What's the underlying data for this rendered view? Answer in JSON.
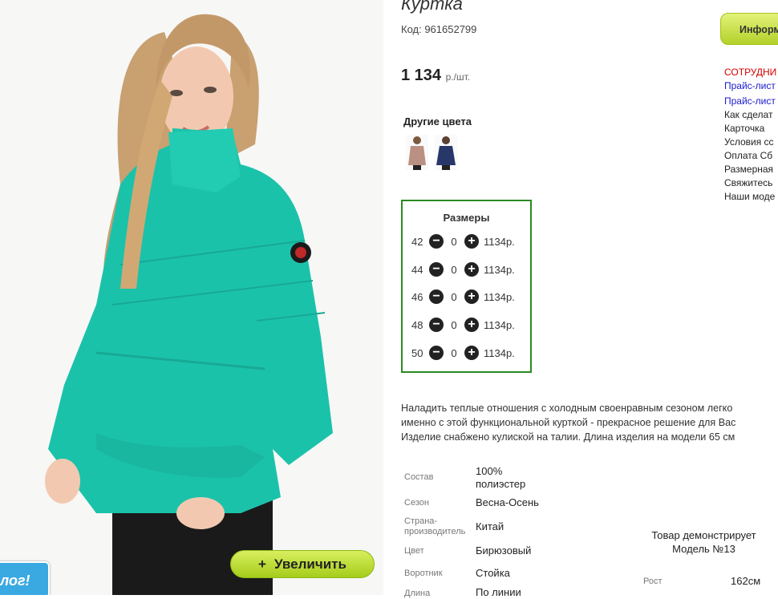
{
  "product": {
    "title": "Куртка",
    "code": "Код: 961652799",
    "price": "1 134",
    "price_unit": "р./шт."
  },
  "other_colors": {
    "label": "Другие цвета",
    "swatches": [
      {
        "name": "beige",
        "color": "#b99081"
      },
      {
        "name": "navy",
        "color": "#27376a"
      }
    ]
  },
  "sizes": {
    "title": "Размеры",
    "rows": [
      {
        "size": "42",
        "qty": "0",
        "price": "1134р."
      },
      {
        "size": "44",
        "qty": "0",
        "price": "1134р."
      },
      {
        "size": "46",
        "qty": "0",
        "price": "1134р."
      },
      {
        "size": "48",
        "qty": "0",
        "price": "1134р."
      },
      {
        "size": "50",
        "qty": "0",
        "price": "1134р."
      }
    ],
    "minus_glyph": "−",
    "plus_glyph": "+"
  },
  "description": [
    "Наладить теплые отношения с холодным своенравным сезоном легко",
    "именно с этой функциональной курткой - прекрасное решение для Вас",
    "Изделие снабжено кулиской на талии. Длина изделия на модели 65 см"
  ],
  "specs": [
    {
      "label": "Состав",
      "value": "100% полиэстер"
    },
    {
      "label": "Сезон",
      "value": "Весна-Осень"
    },
    {
      "label": "Страна-производитель",
      "value": "Китай"
    },
    {
      "label": "Цвет",
      "value": "Бирюзовый"
    },
    {
      "label": "Воротник",
      "value": "Стойка"
    },
    {
      "label": "Длина",
      "value": "По линии"
    }
  ],
  "model": {
    "note_line1": "Товар демонстрирует",
    "note_line2": "Модель №13",
    "height_label": "Рост",
    "height_value": "162см"
  },
  "zoom_button": {
    "icon": "+",
    "label": "Увеличить"
  },
  "catalog_tab": "лог!",
  "info_button": "Информ",
  "side_links": [
    {
      "text": "СОТРУДНИ",
      "color": "#d40000"
    },
    {
      "text": "Прайс-лист",
      "color": "#1a1acc"
    },
    {
      "text": "Прайс-лист",
      "color": "#1a1acc"
    },
    {
      "text": "Как сделат",
      "color": "#222222"
    },
    {
      "text": "Карточка",
      "color": "#222222"
    },
    {
      "text": "Условия сс",
      "color": "#222222"
    },
    {
      "text": "Оплата Сб",
      "color": "#222222"
    },
    {
      "text": "Размерная",
      "color": "#222222"
    },
    {
      "text": "Свяжитесь",
      "color": "#222222"
    },
    {
      "text": "Наши моде",
      "color": "#222222"
    }
  ],
  "colors": {
    "jacket": "#1bc2aa",
    "hair": "#c9a070",
    "size_box_border": "#2b8a20",
    "button_green": "#b3d12a",
    "catalog_blue": "#3aa9e2"
  }
}
